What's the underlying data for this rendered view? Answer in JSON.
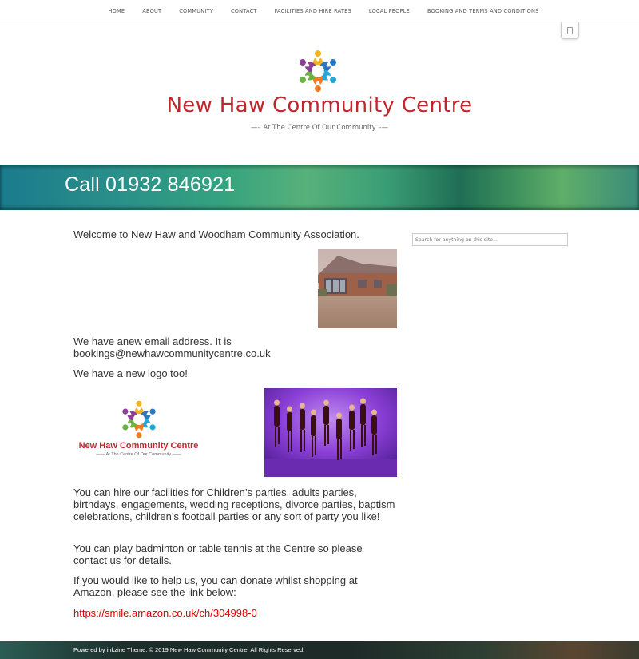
{
  "nav": {
    "items": [
      "HOME",
      "ABOUT",
      "COMMUNITY",
      "CONTACT",
      "FACILITIES AND HIRE RATES",
      "LOCAL PEOPLE",
      "BOOKING AND TERMS AND CONDITIONS"
    ]
  },
  "header": {
    "title": "New Haw Community Centre",
    "tagline": "—– At The Centre Of Our Community –—"
  },
  "banner": {
    "text": "Call 01932 846921"
  },
  "main": {
    "welcome": "Welcome to New Haw and Woodham Community Association.",
    "email_text": "We have anew email address. It is bookings@newhawcommunitycentre.co.uk",
    "logo_text": "We have a new logo too!",
    "logo_card_title": "New Haw Community Centre",
    "logo_card_tagline": "—— At The Centre Of Our Community ——",
    "hire_text": "You can hire our facilities for Children’s parties, adults parties, birthdays, engagements, wedding receptions, divorce parties, baptism celebrations, children’s football parties or any sort of party you like!",
    "sports_text": "You can play badminton or table tennis at the Centre so please contact us for details.",
    "donate_text": "If you would like to help us, you can donate whilst shopping at Amazon, please see the link below:",
    "amazon_link": "https://smile.amazon.co.uk/ch/304998-0"
  },
  "sidebar": {
    "search_placeholder": "Search for anything on this site..."
  },
  "footer": {
    "text": "Powered by inkzine Theme. © 2019 New Haw Community Centre. All Rights Reserved."
  },
  "colors": {
    "title_red": "#c0272d",
    "link_red": "#e00000",
    "banner_teal": "#2a8f8a",
    "banner_green": "#57b17a"
  }
}
